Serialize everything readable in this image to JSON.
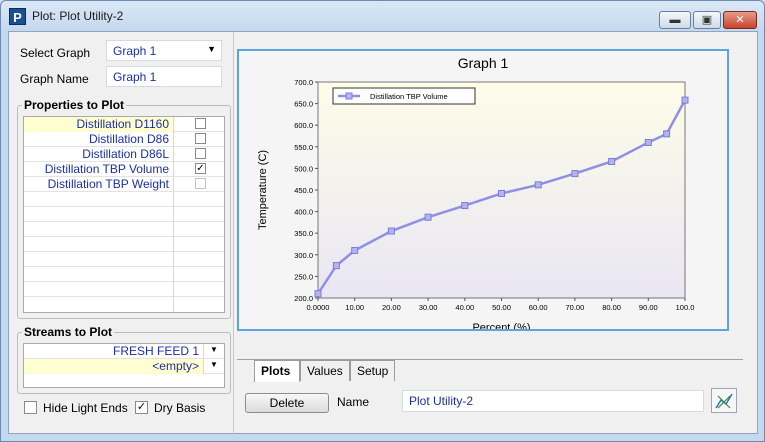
{
  "window": {
    "title": "Plot: Plot Utility-2",
    "icon": "P"
  },
  "controls": {
    "select_graph_label": "Select Graph",
    "select_graph_value": "Graph 1",
    "graph_name_label": "Graph Name",
    "graph_name_value": "Graph 1"
  },
  "properties": {
    "title": "Properties to Plot",
    "items": [
      {
        "label": "Distillation D1160",
        "checked": false
      },
      {
        "label": "Distillation D86",
        "checked": false
      },
      {
        "label": "Distillation D86L",
        "checked": false
      },
      {
        "label": "Distillation TBP Volume",
        "checked": true
      },
      {
        "label": "Distillation TBP Weight",
        "checked": false
      }
    ]
  },
  "streams": {
    "title": "Streams to Plot",
    "items": [
      "FRESH FEED 1",
      "<empty>"
    ]
  },
  "options": {
    "hide_light_ends": {
      "label": "Hide Light Ends",
      "checked": false
    },
    "dry_basis": {
      "label": "Dry Basis",
      "checked": true
    }
  },
  "tabs": [
    "Plots",
    "Values",
    "Setup"
  ],
  "bottom": {
    "delete_label": "Delete",
    "name_label": "Name",
    "name_value": "Plot Utility-2"
  },
  "chart_data": {
    "type": "line",
    "title": "Graph 1",
    "xlabel": "Percent (%)",
    "ylabel": "Temperature (C)",
    "xlim": [
      0,
      100
    ],
    "ylim": [
      200,
      700
    ],
    "xticks": [
      "0.0000",
      "10.00",
      "20.00",
      "30.00",
      "40.00",
      "50.00",
      "60.00",
      "70.00",
      "80.00",
      "90.00",
      "100.0"
    ],
    "yticks": [
      "200.0",
      "250.0",
      "300.0",
      "350.0",
      "400.0",
      "450.0",
      "500.0",
      "550.0",
      "600.0",
      "650.0",
      "700.0"
    ],
    "legend_position": "top-left",
    "series": [
      {
        "name": "Distillation TBP Volume",
        "color": "#8f8fe6",
        "x": [
          0,
          5,
          10,
          20,
          30,
          40,
          50,
          60,
          70,
          80,
          90,
          95,
          100
        ],
        "y": [
          210,
          275,
          310,
          355,
          387,
          414,
          442,
          462,
          488,
          516,
          560,
          580,
          658
        ]
      }
    ]
  }
}
